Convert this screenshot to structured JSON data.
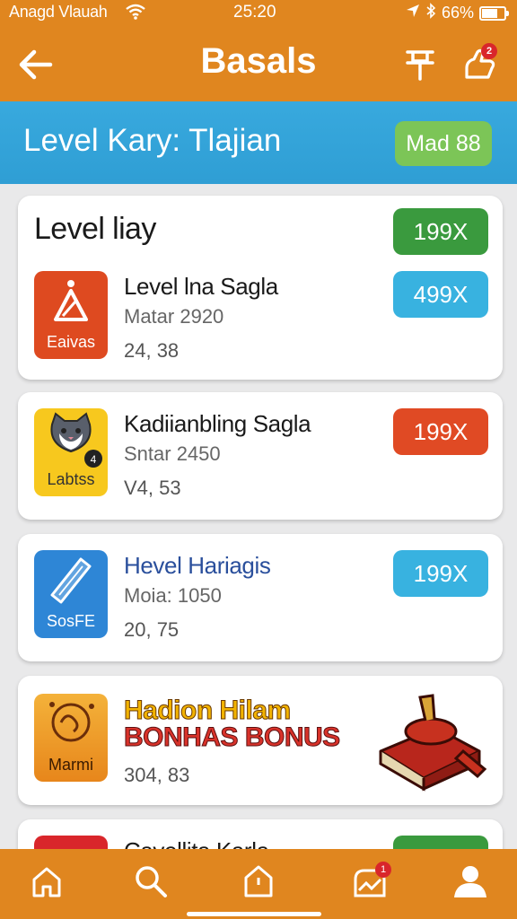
{
  "status_bar": {
    "carrier": "Anagd Vlauah",
    "time": "25:20",
    "battery": "66%",
    "battery_level": 0.66
  },
  "header": {
    "title": "Basals",
    "notification_count": "2"
  },
  "banner": {
    "heading": "Level Kary: Tlajian",
    "badge": "Mad 88"
  },
  "section": {
    "title": "Level liay",
    "price": "199X"
  },
  "apps": [
    {
      "name": "Level lna Sagla",
      "sub": "Matar 2920",
      "meta": "24, 38",
      "icon_label": "Eaivas",
      "icon": "warning-triangle-icon",
      "price": "499X",
      "price_color": "#38b2e0",
      "icon_color": "#de4a20"
    },
    {
      "name": "Kadiianbling Sagla",
      "sub": "Sntar 2450",
      "meta": "V4, 53",
      "icon_label": "Labtss",
      "icon": "cat-icon",
      "price": "199X",
      "price_color": "#e04a24",
      "icon_color": "#f7c81e"
    },
    {
      "name": "Hevel Hariagis",
      "sub": "Moia: 1050",
      "meta": "20, 75",
      "icon_label": "SosFE",
      "icon": "ruler-icon",
      "price": "199X",
      "price_color": "#38b2e0",
      "icon_color": "#2e86d6"
    }
  ],
  "promo": {
    "line1": "Hadion Hilam",
    "line2": "BONHAS BONUS",
    "meta": "304, 83",
    "icon_label": "Marmi",
    "icon": "zodiac-icon",
    "image": "book-anvil-icon"
  },
  "partial_item": {
    "name": "Cavellita Karla"
  },
  "bottom_nav": {
    "notification_count": "1"
  },
  "colors": {
    "accent": "#e0861f",
    "banner": "#38a9de",
    "badge": "#7cc557",
    "green_price": "#3a9a3e"
  }
}
